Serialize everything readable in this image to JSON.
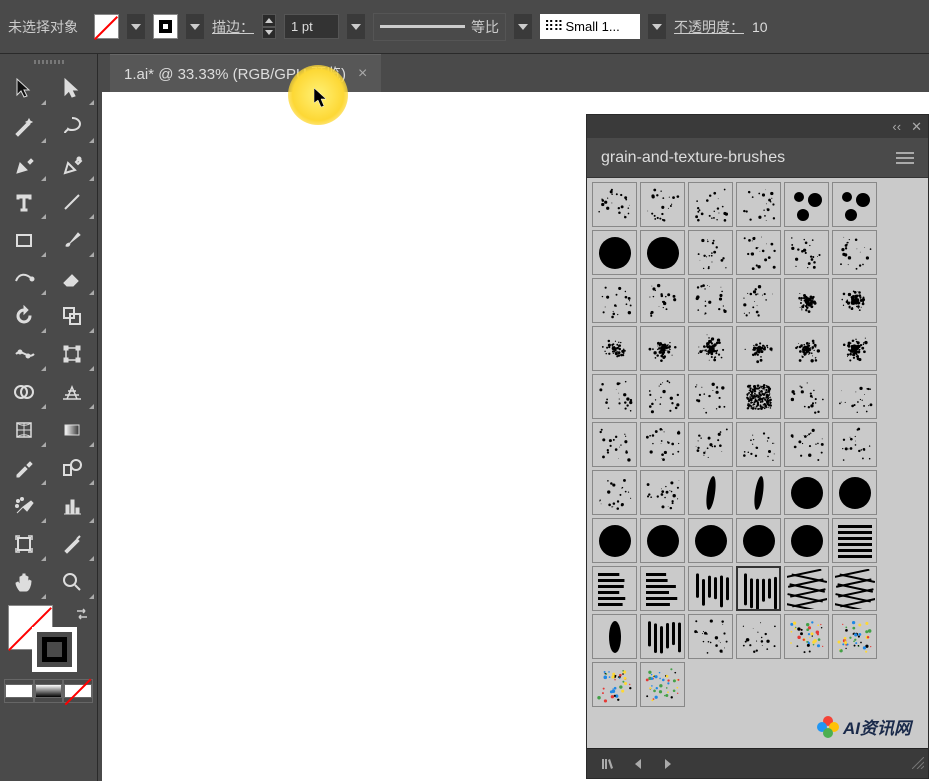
{
  "topbar": {
    "no_selection": "未选择对象",
    "stroke_label": "描边：",
    "stroke_weight": "1 pt",
    "profile_label": "等比",
    "brush_name": "Small 1...",
    "opacity_label": "不透明度：",
    "opacity_value": "10"
  },
  "tab": {
    "title": "1.ai* @ 33.33% (RGB/GPU 预览)"
  },
  "panel": {
    "title": "grain-and-texture-brushes"
  },
  "tools": [
    [
      "selection-tool",
      "direct-selection-tool"
    ],
    [
      "magic-wand-tool",
      "lasso-tool"
    ],
    [
      "pen-tool",
      "curvature-tool"
    ],
    [
      "type-tool",
      "line-tool"
    ],
    [
      "rectangle-tool",
      "paintbrush-tool"
    ],
    [
      "shaper-tool",
      "eraser-tool"
    ],
    [
      "rotate-tool",
      "scale-tool"
    ],
    [
      "width-tool",
      "free-transform-tool"
    ],
    [
      "shape-builder-tool",
      "perspective-grid-tool"
    ],
    [
      "mesh-tool",
      "gradient-tool"
    ],
    [
      "eyedropper-tool",
      "blend-tool"
    ],
    [
      "symbol-sprayer-tool",
      "column-graph-tool"
    ],
    [
      "artboard-tool",
      "slice-tool"
    ],
    [
      "hand-tool",
      "zoom-tool"
    ]
  ],
  "brushes": [
    "spatter-1",
    "spatter-2",
    "spatter-3",
    "spatter-4",
    "dots-big",
    "dots-bigger",
    "solid-circle-1",
    "solid-circle-2",
    "grain-1",
    "grain-2",
    "grain-3",
    "grain-4",
    "noise-1",
    "noise-2",
    "noise-3",
    "noise-4",
    "splash-1",
    "splash-2",
    "cluster-1",
    "cluster-2",
    "cluster-3",
    "cluster-4",
    "cluster-5",
    "cluster-6",
    "haze-1",
    "haze-2",
    "haze-3",
    "dense-grain",
    "sparse-1",
    "sparse-2",
    "dust-1",
    "dust-2",
    "dust-3",
    "dust-4",
    "dust-5",
    "dust-6",
    "fleck-1",
    "fleck-2",
    "stroke-1",
    "stroke-2",
    "disc-1",
    "disc-2",
    "disc-3",
    "disc-4",
    "disc-5",
    "disc-6",
    "disc-7",
    "hatch-lines",
    "hatch-1",
    "hatch-2",
    "bars-1",
    "bars-2",
    "weave-1",
    "weave-2",
    "blob-1",
    "strokes-multi",
    "faint-1",
    "faint-2",
    "confetti-1",
    "confetti-2",
    "confetti-3",
    "confetti-4"
  ],
  "watermark": "AI资讯网"
}
